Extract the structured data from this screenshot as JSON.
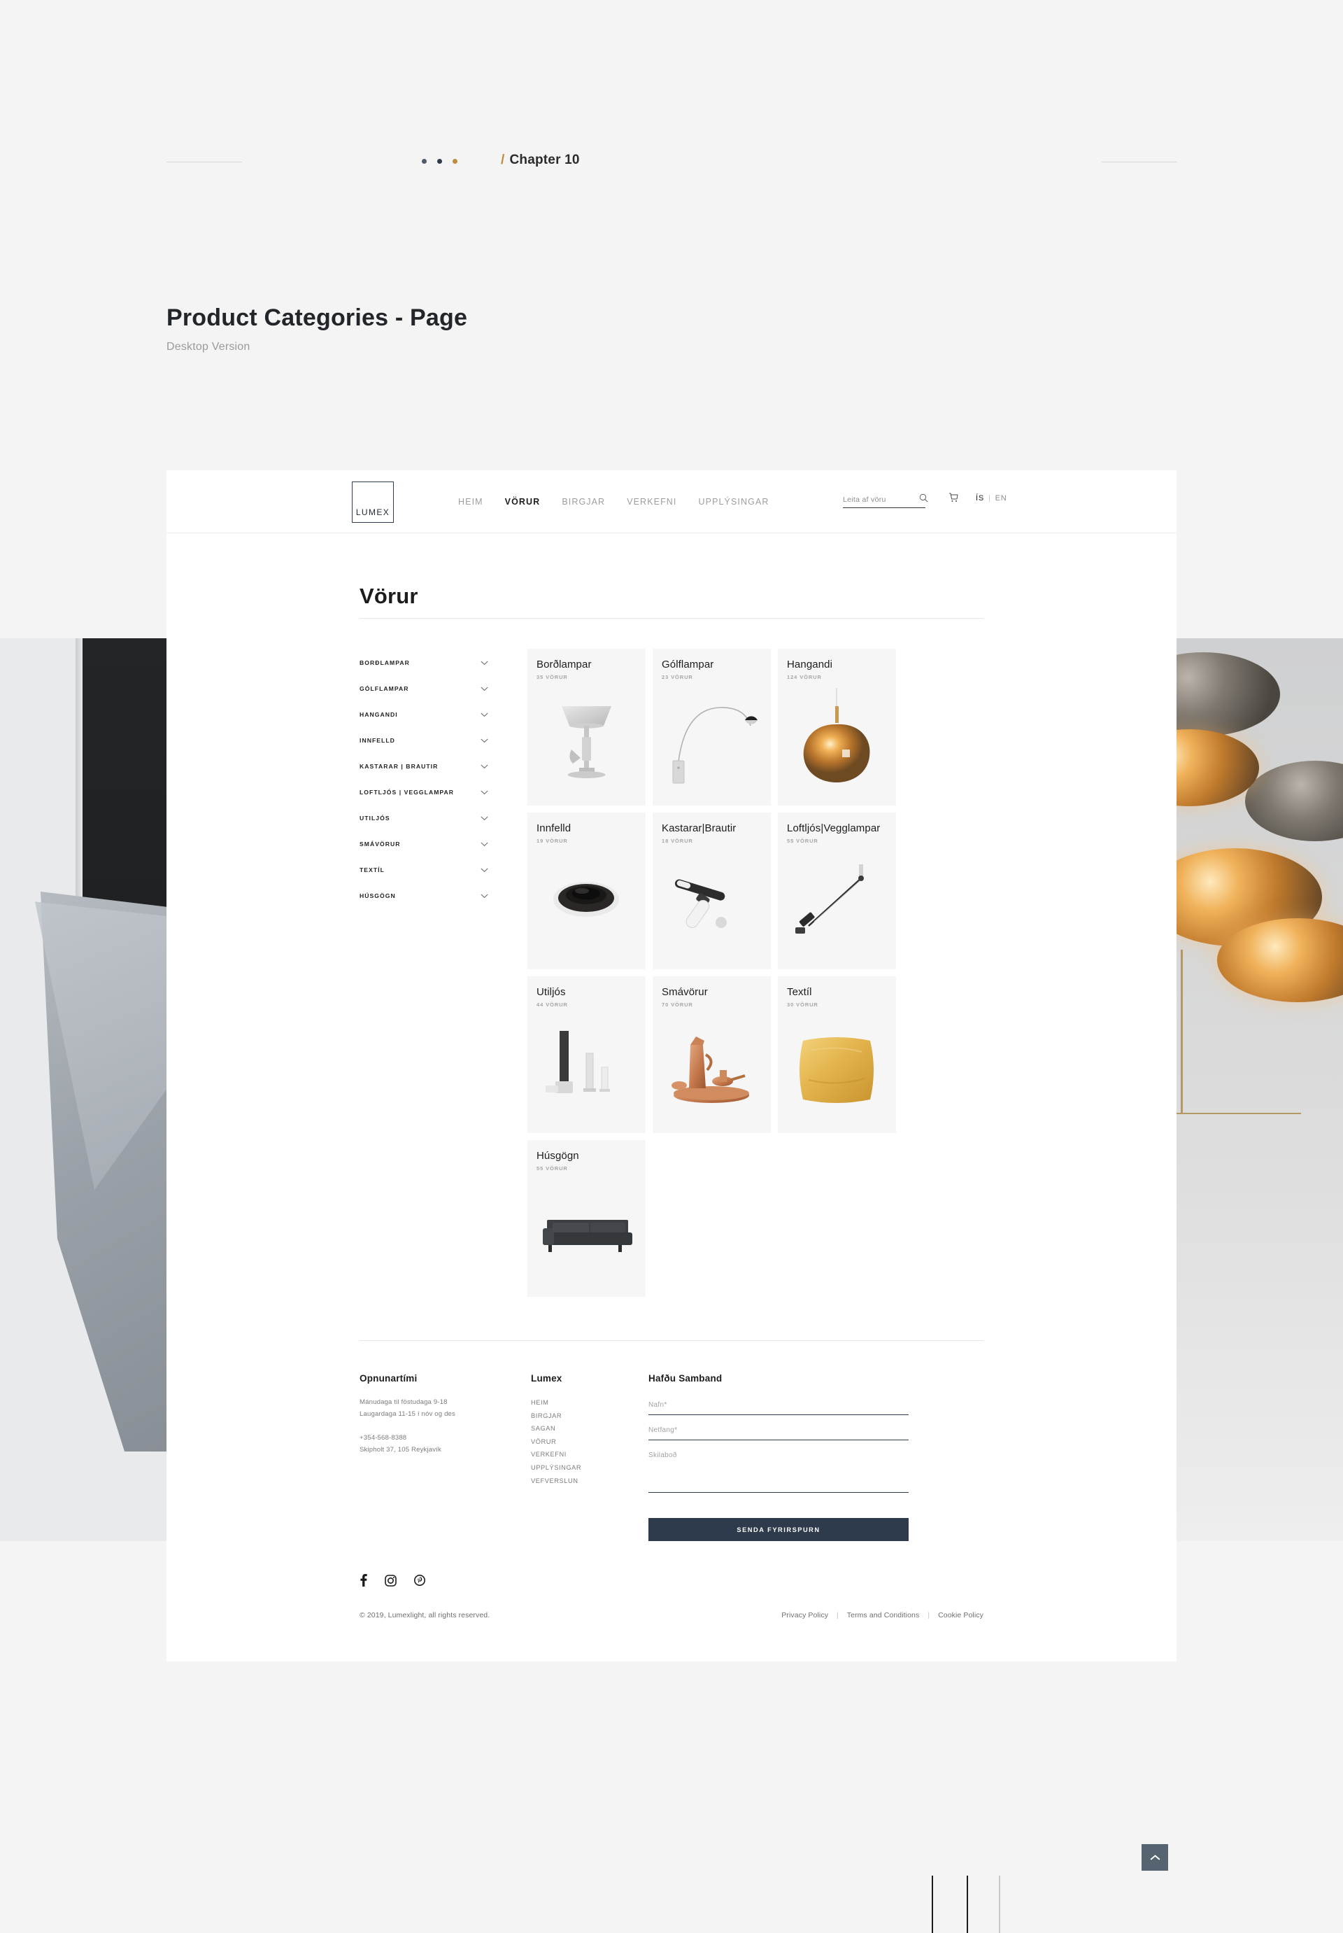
{
  "deck": {
    "chapter_label": "Chapter 10",
    "chapter_slash": "/",
    "title": "Product Categories - Page",
    "subtitle": "Desktop Version",
    "dot_colors": [
      "#4c5a6b",
      "#2d3b4c",
      "#c08a3e"
    ],
    "accent_color": "#c08a3e"
  },
  "header": {
    "logo": "LUMEX",
    "nav": [
      {
        "label": "HEIM",
        "active": false
      },
      {
        "label": "VÖRUR",
        "active": true
      },
      {
        "label": "BIRGJAR",
        "active": false
      },
      {
        "label": "VERKEFNI",
        "active": false
      },
      {
        "label": "UPPLÝSINGAR",
        "active": false
      }
    ],
    "search_placeholder": "Leita af vöru",
    "search_value": "",
    "lang_active": "ÍS",
    "lang_sep": "|",
    "lang_other": "EN"
  },
  "page": {
    "title": "Vörur"
  },
  "sidebar": {
    "items": [
      {
        "label": "BORÐLAMPAR"
      },
      {
        "label": "GÓLFLAMPAR"
      },
      {
        "label": "HANGANDI"
      },
      {
        "label": "INNFELLD"
      },
      {
        "label": "KASTARAR | BRAUTIR"
      },
      {
        "label": "LOFTLJÓS | VEGGLAMPAR"
      },
      {
        "label": "UTILJÓS"
      },
      {
        "label": "SMÁVÖRUR"
      },
      {
        "label": "TEXTÍL"
      },
      {
        "label": "HÚSGÖGN"
      }
    ]
  },
  "categories": [
    {
      "title": "Borðlampar",
      "count": "35 VÖRUR",
      "art": "table-lamp"
    },
    {
      "title": "Gólflampar",
      "count": "23 VÖRUR",
      "art": "arc-lamp"
    },
    {
      "title": "Hangandi",
      "count": "124 VÖRUR",
      "art": "pendant-blob"
    },
    {
      "title": "Innfelld",
      "count": "19 VÖRUR",
      "art": "recessed"
    },
    {
      "title": "Kastarar|Brautir",
      "count": "18 VÖRUR",
      "art": "track-spot"
    },
    {
      "title": "Loftljós|Vegglampar",
      "count": "55 VÖRUR",
      "art": "wall-arm"
    },
    {
      "title": "Utiljós",
      "count": "44 VÖRUR",
      "art": "bollard"
    },
    {
      "title": "Smávörur",
      "count": "70 VÖRUR",
      "art": "copper-set"
    },
    {
      "title": "Textíl",
      "count": "30 VÖRUR",
      "art": "cushion"
    },
    {
      "title": "Húsgögn",
      "count": "55 VÖRUR",
      "art": "sofa"
    }
  ],
  "footer": {
    "hours": {
      "heading": "Opnunartími",
      "line1": "Mánudaga til föstudaga 9-18",
      "line2": "Laugardaga 11-15 í nóv og des",
      "phone": "+354-568-8388",
      "address": "Skipholt 37, 105 Reykjavík"
    },
    "nav": {
      "heading": "Lumex",
      "links": [
        "HEIM",
        "BIRGJAR",
        "SAGAN",
        "VÖRUR",
        "VERKEFNI",
        "UPPLÝSINGAR",
        "VEFVERSLUN"
      ]
    },
    "contact": {
      "heading": "Hafðu Samband",
      "name_placeholder": "Nafn*",
      "name_value": "",
      "email_placeholder": "Netfang*",
      "email_value": "",
      "message_placeholder": "Skilaboð",
      "message_value": "",
      "submit_label": "SENDA FYRIRSPURN",
      "submit_color": "#2d3b4c"
    },
    "social": [
      "facebook-icon",
      "instagram-icon",
      "pinterest-icon"
    ],
    "copyright": "© 2019, Lumexlight, all rights reserved.",
    "policies": [
      "Privacy Policy",
      "Terms and Conditions",
      "Cookie Policy"
    ],
    "policy_separator": "|"
  },
  "to_top": {
    "label": "scroll-to-top",
    "color": "#566472"
  }
}
